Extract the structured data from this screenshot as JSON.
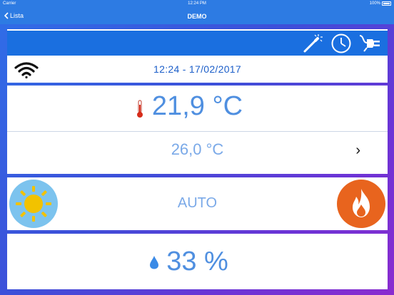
{
  "status": {
    "carrier": "Carrier",
    "time": "12:24 PM",
    "battery": "100%"
  },
  "nav": {
    "back_label": "Lista",
    "title": "DEMO"
  },
  "toolbar": {
    "icons": [
      "magic-wand-icon",
      "clock-icon",
      "power-plug-icon"
    ]
  },
  "datetime": "12:24 - 17/02/2017",
  "temperature": {
    "current": "21,9 °C",
    "setpoint": "26,0 °C"
  },
  "mode": {
    "label": "AUTO"
  },
  "humidity": {
    "value": "33 %"
  },
  "colors": {
    "accent": "#1a6fe0",
    "sun_bg": "#7cc3ee",
    "sun": "#f2c200",
    "fire_bg": "#e8641e",
    "text_blue": "#4f8fe0"
  }
}
